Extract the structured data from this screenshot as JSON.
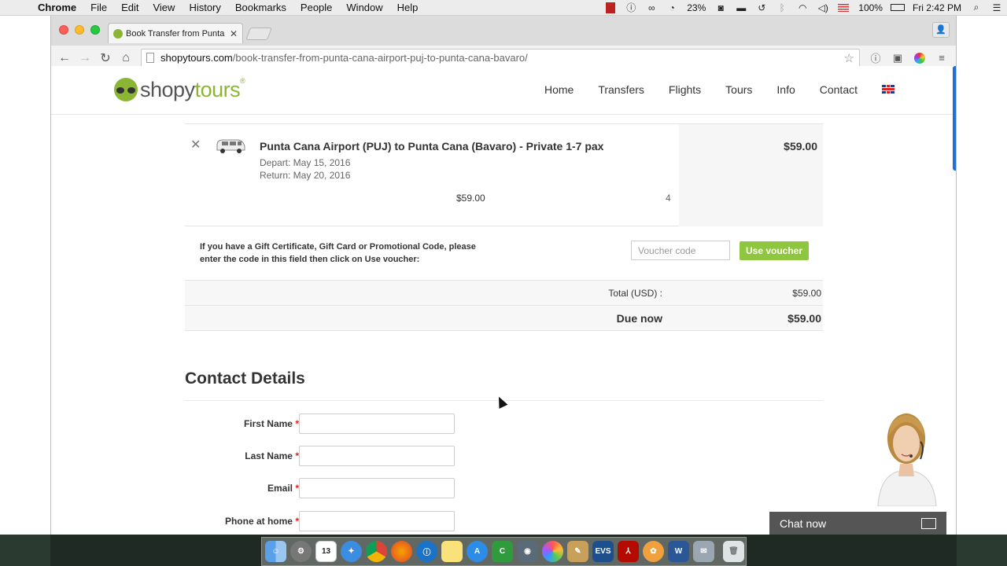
{
  "menubar": {
    "app": "Chrome",
    "items": [
      "File",
      "Edit",
      "View",
      "History",
      "Bookmarks",
      "People",
      "Window",
      "Help"
    ],
    "battery_small": "23%",
    "battery": "100%",
    "clock": "Fri 2:42 PM"
  },
  "browser": {
    "tab_title": "Book Transfer from Punta C",
    "url_domain": "shopytours.com",
    "url_path": "/book-transfer-from-punta-cana-airport-puj-to-punta-cana-bavaro/"
  },
  "site": {
    "logo_part1": "shopy",
    "logo_part2": "tours",
    "logo_reg": "®",
    "nav": [
      "Home",
      "Transfers",
      "Flights",
      "Tours",
      "Info",
      "Contact"
    ]
  },
  "cart": {
    "remove_glyph": "✕",
    "product_name": "Punta Cana Airport (PUJ) to Punta Cana (Bavaro) - Private 1-7 pax",
    "depart": "Depart: May 15, 2016",
    "return": "Return: May 20, 2016",
    "unit_price": "$59.00",
    "quantity": "4",
    "line_total": "$59.00"
  },
  "voucher": {
    "text": "If you have a Gift Certificate, Gift Card or Promotional Code, please enter the code in this field then click on Use voucher:",
    "placeholder": "Voucher code",
    "button": "Use voucher"
  },
  "totals": {
    "total_label": "Total (USD) :",
    "total_value": "$59.00",
    "due_label": "Due now",
    "due_value": "$59.00"
  },
  "contact": {
    "title": "Contact Details",
    "fields": [
      "First Name",
      "Last Name",
      "Email",
      "Phone at home"
    ],
    "required_mark": "*"
  },
  "chat": {
    "label": "Chat now"
  },
  "dock": {
    "calendar_day": "13",
    "evs_label": "EVS"
  }
}
